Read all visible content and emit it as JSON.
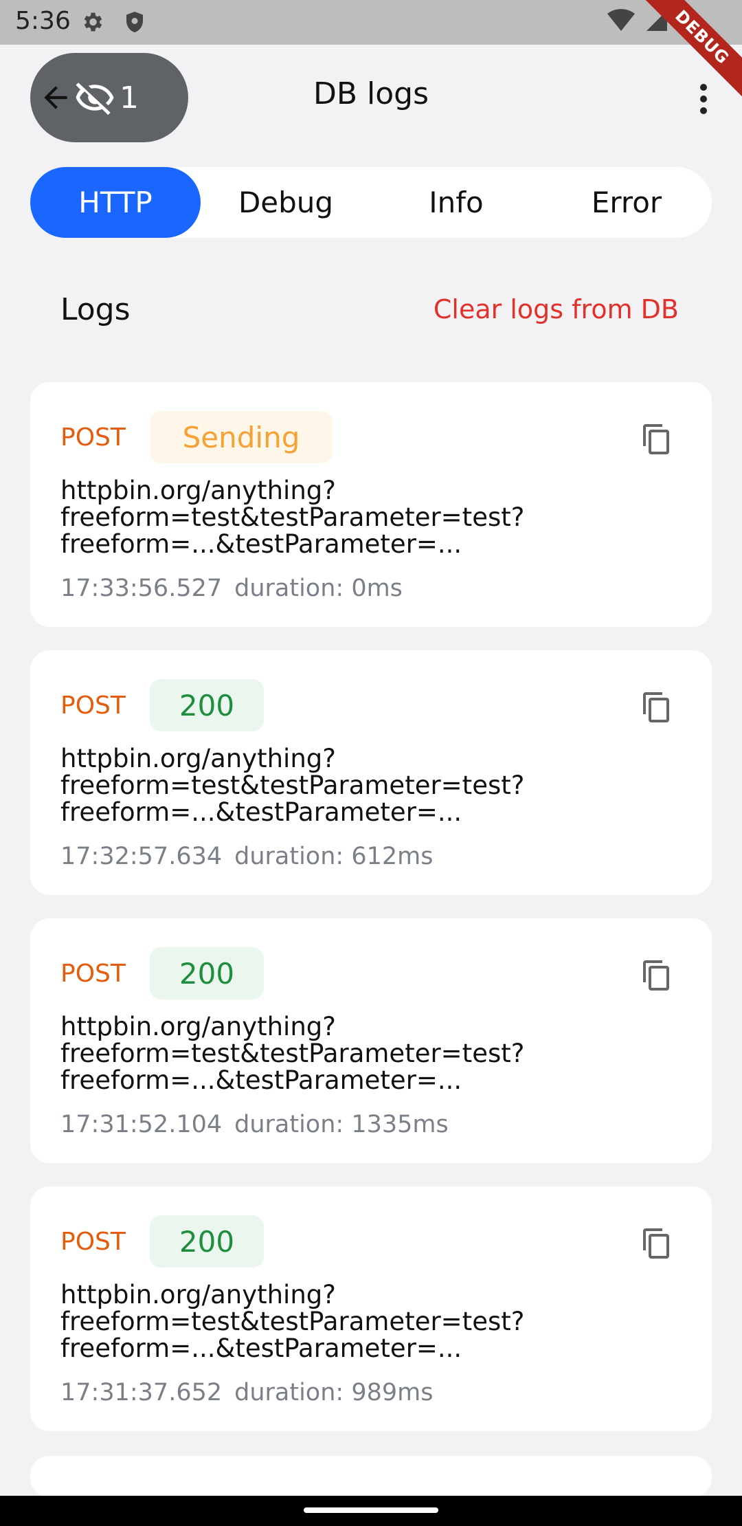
{
  "status_bar": {
    "time": "5:36"
  },
  "debug_ribbon": "DEBUG",
  "app_bar": {
    "hidden_count": "1",
    "title": "DB logs"
  },
  "tabs": [
    {
      "label": "HTTP",
      "active": true
    },
    {
      "label": "Debug",
      "active": false
    },
    {
      "label": "Info",
      "active": false
    },
    {
      "label": "Error",
      "active": false
    }
  ],
  "logs_header": {
    "title": "Logs",
    "clear_label": "Clear logs from DB"
  },
  "logs": [
    {
      "method": "POST",
      "status": "Sending",
      "url_line1": "httpbin.org/anything?",
      "url_line2": "freeform=test&testParameter=test?",
      "url_line3": "freeform=...&testParameter=...",
      "time": "17:33:56.527",
      "duration": "duration: 0ms"
    },
    {
      "method": "POST",
      "status": "200",
      "url_line1": "httpbin.org/anything?",
      "url_line2": "freeform=test&testParameter=test?",
      "url_line3": "freeform=...&testParameter=...",
      "time": "17:32:57.634",
      "duration": "duration: 612ms"
    },
    {
      "method": "POST",
      "status": "200",
      "url_line1": "httpbin.org/anything?",
      "url_line2": "freeform=test&testParameter=test?",
      "url_line3": "freeform=...&testParameter=...",
      "time": "17:31:52.104",
      "duration": "duration: 1335ms"
    },
    {
      "method": "POST",
      "status": "200",
      "url_line1": "httpbin.org/anything?",
      "url_line2": "freeform=test&testParameter=test?",
      "url_line3": "freeform=...&testParameter=...",
      "time": "17:31:37.652",
      "duration": "duration: 989ms"
    }
  ],
  "colors": {
    "accent": "#1a66ff",
    "method": "#e35d0e",
    "danger": "#e0312b",
    "sending": "#f5a235",
    "success": "#1e8e3e"
  }
}
